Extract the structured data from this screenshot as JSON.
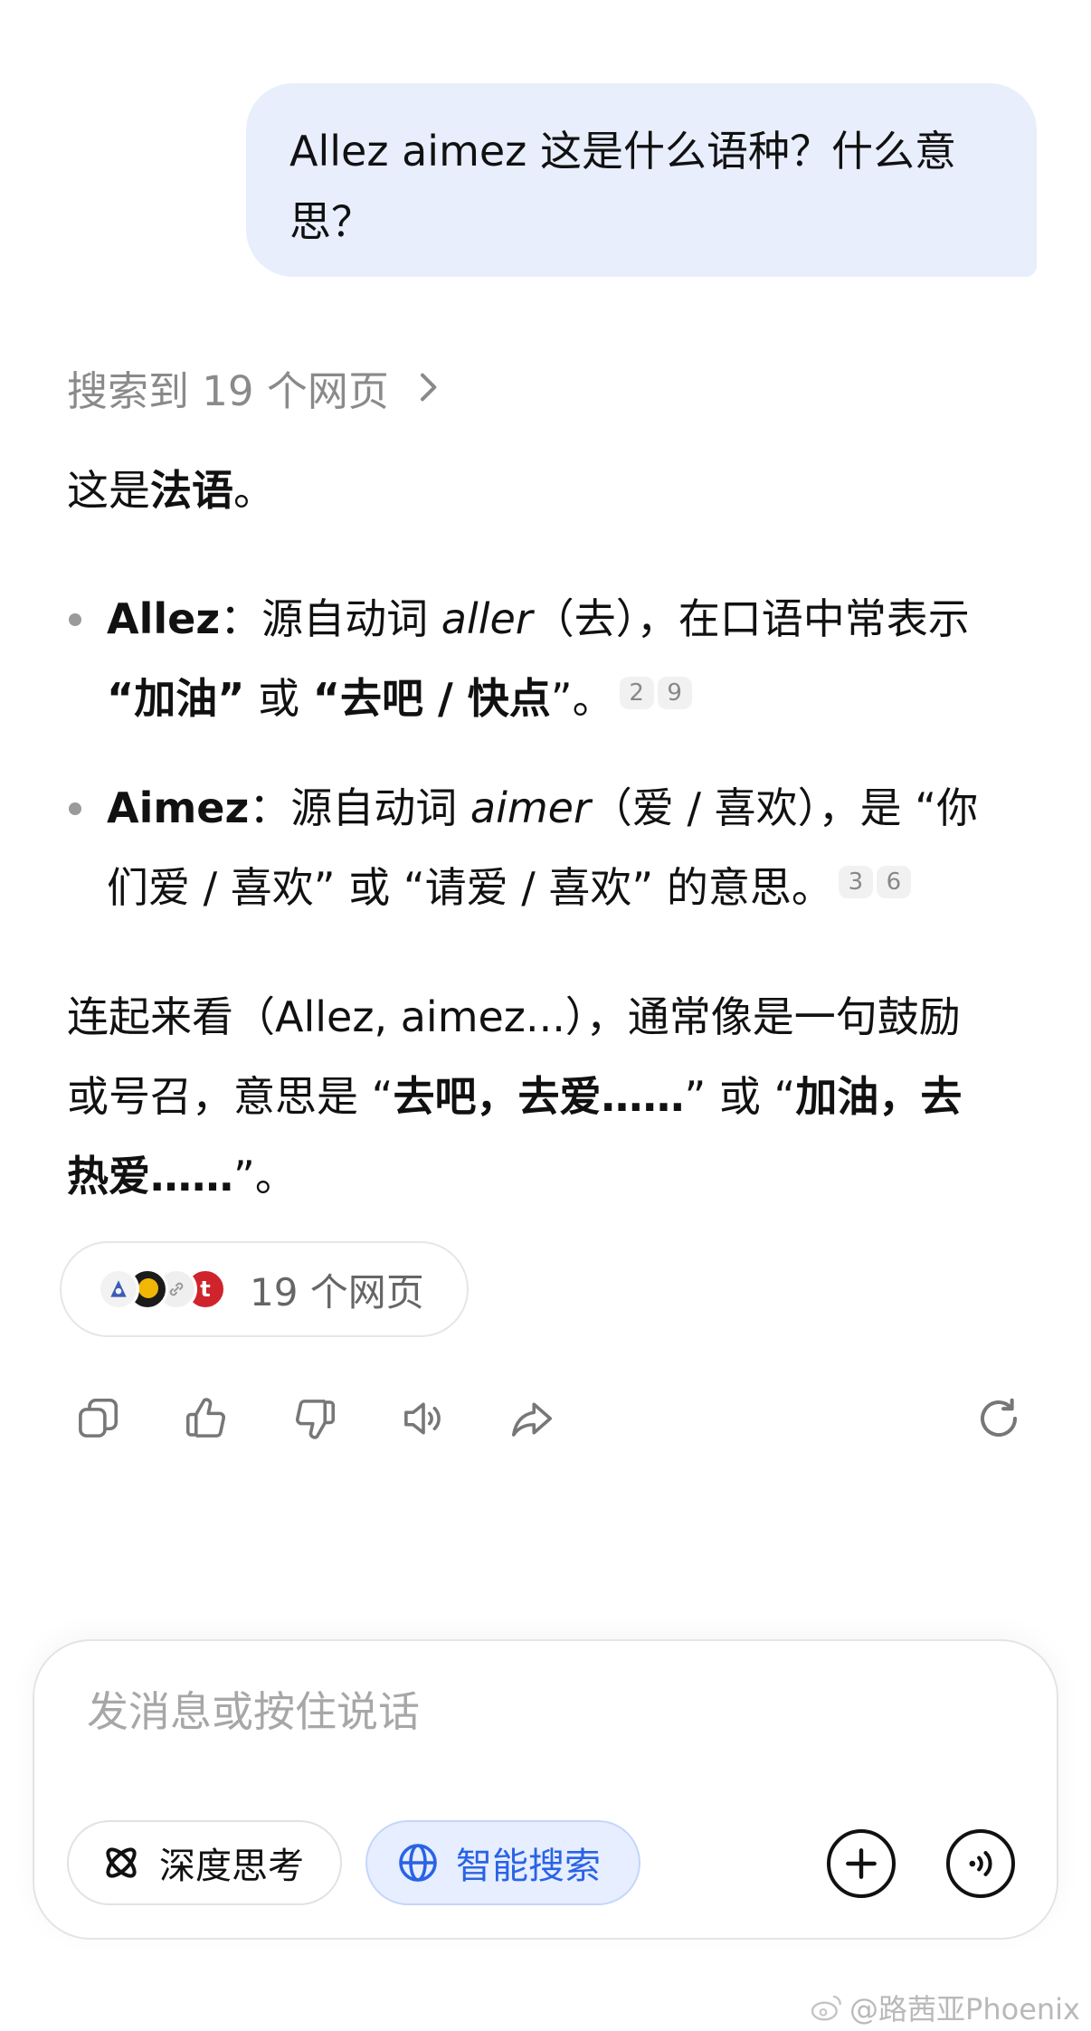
{
  "user_message": {
    "line1": "Allez aimez 这是什么语种？什么意",
    "line2": "思？"
  },
  "search_summary": {
    "label": "搜索到 19 个网页",
    "icon": "chevron-right-icon"
  },
  "answer": {
    "intro_prefix": "这是",
    "intro_bold": "法语",
    "intro_suffix": "。",
    "bullets": [
      {
        "term": "Allez",
        "sep": "：源自动词 ",
        "verb": "aller",
        "line1_rest": "（去），在口语中常表示",
        "q1_open": "“",
        "bold1": "加油",
        "q1_close": "”",
        "mid": " 或 ",
        "q2_open": "“",
        "bold2": "去吧 / 快点",
        "q2_close": "”。",
        "cites": [
          "2",
          "9"
        ]
      },
      {
        "term": "Aimez",
        "sep": "：源自动词 ",
        "verb": "aimer",
        "line1_rest": "（爱 / 喜欢），是 “你",
        "line2": "们爱 / 喜欢” 或 “请爱 / 喜欢” 的意思。",
        "cites": [
          "3",
          "6"
        ]
      }
    ],
    "conclusion_line1": "连起来看（Allez, aimez...），通常像是一句鼓励",
    "conclusion_line2_prefix": "或号召，意思是 “",
    "conclusion_bold1": "去吧，去爱……",
    "conclusion_mid": "” 或 “",
    "conclusion_bold2a": "加油，去",
    "conclusion_bold2b": "热爱……",
    "conclusion_end": "”。"
  },
  "sources": {
    "label": "19 个网页",
    "favicons": [
      "site-logo-icon",
      "colorful-logo-icon",
      "link-icon",
      "t-logo-icon"
    ],
    "fav4_letter": "t"
  },
  "actions": [
    "copy-icon",
    "thumbs-up-icon",
    "thumbs-down-icon",
    "speaker-icon",
    "share-icon",
    "regenerate-icon"
  ],
  "composer": {
    "placeholder": "发消息或按住说话",
    "deep_think": "深度思考",
    "smart_search": "智能搜索",
    "accent": "#2a63e4"
  },
  "watermark": "@路茜亚Phoenix"
}
